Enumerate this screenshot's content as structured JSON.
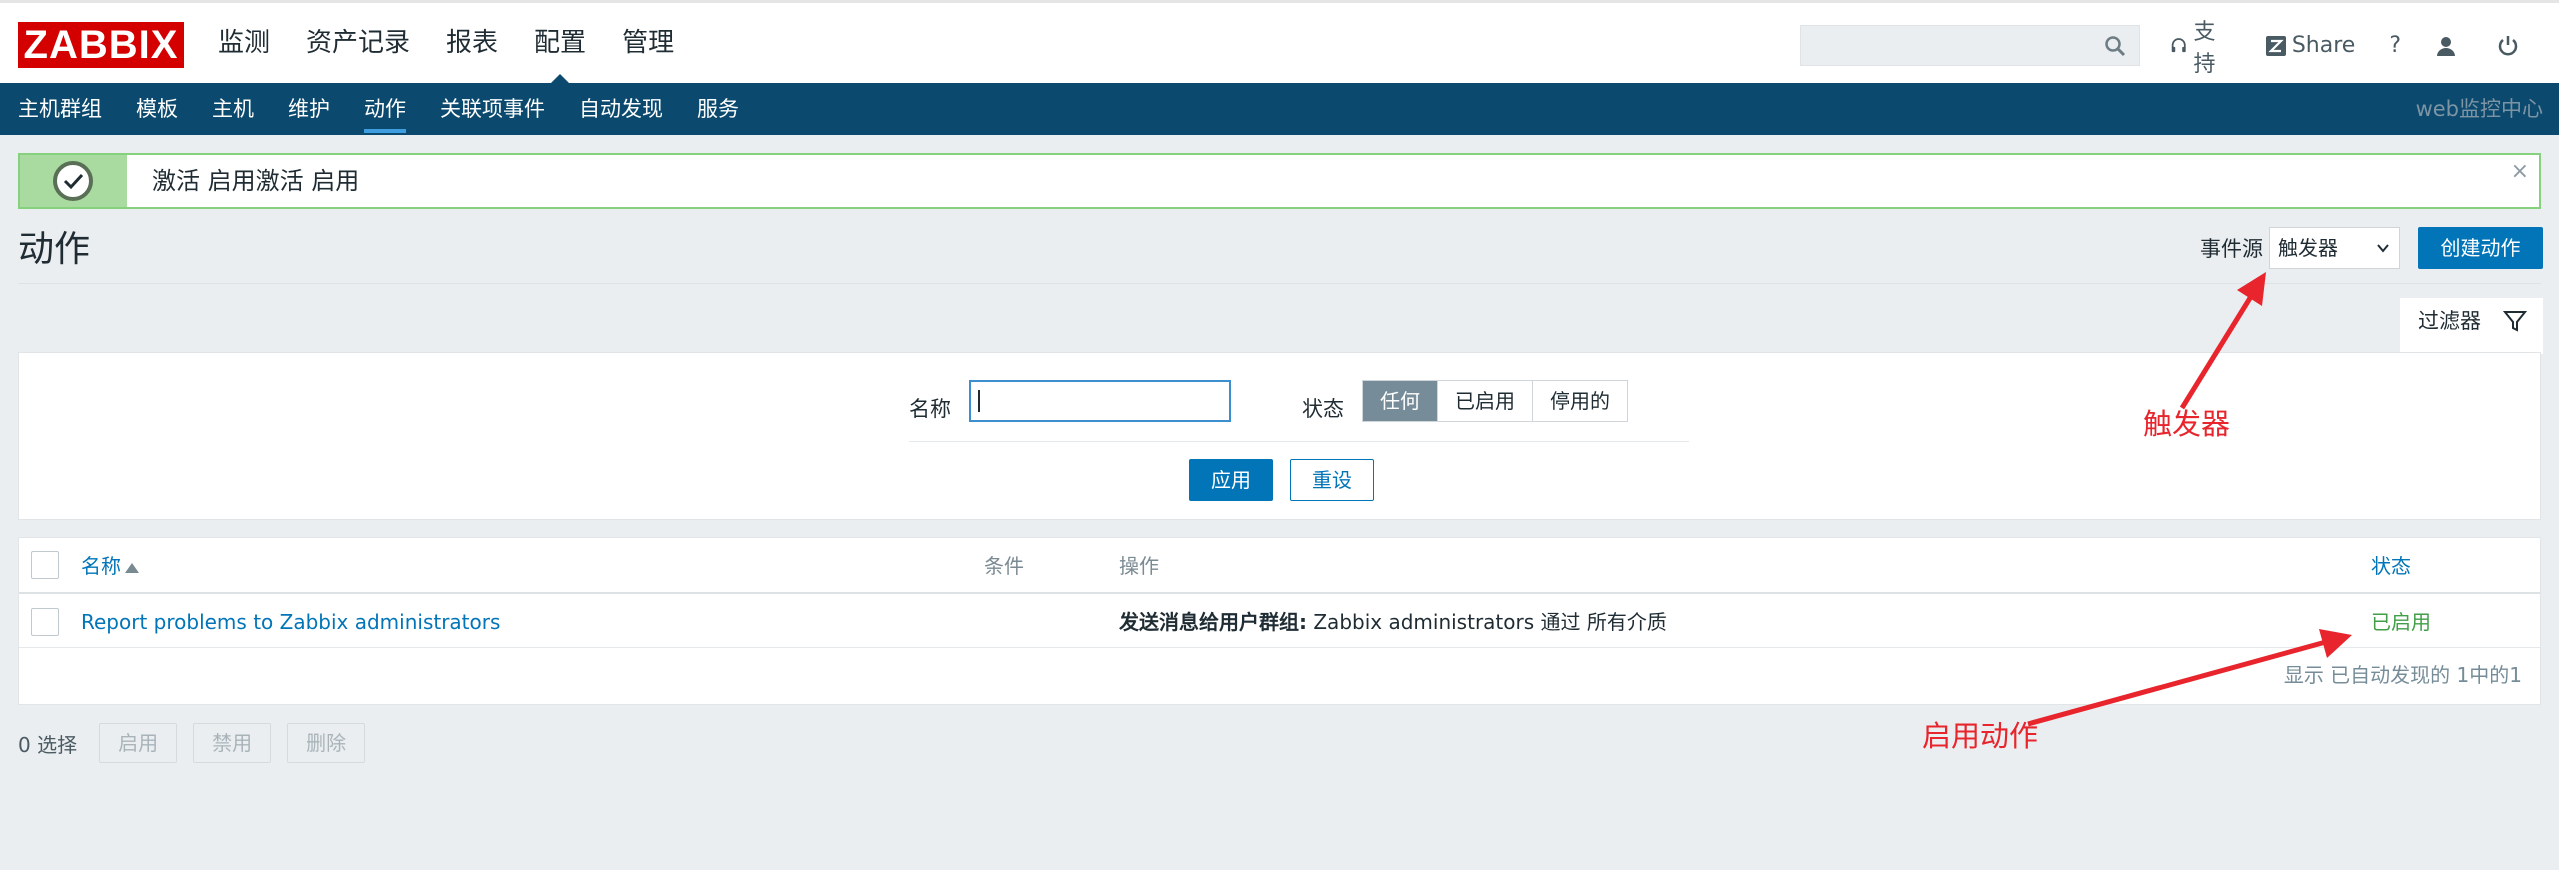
{
  "brand": {
    "logo": "ZABBIX"
  },
  "main_menu": [
    "监测",
    "资产记录",
    "报表",
    "配置",
    "管理"
  ],
  "main_menu_active": "配置",
  "header_tools": {
    "support": "支持",
    "share": "Share",
    "help": "?"
  },
  "sub_menu": [
    "主机群组",
    "模板",
    "主机",
    "维护",
    "动作",
    "关联项事件",
    "自动发现",
    "服务"
  ],
  "sub_menu_active": "动作",
  "sub_right": "web监控中心",
  "message": {
    "text": "激活 启用激活 启用",
    "close": "×"
  },
  "page": {
    "title": "动作",
    "event_source_label": "事件源",
    "event_source_value": "触发器",
    "create_button": "创建动作"
  },
  "filter": {
    "tab_label": "过滤器",
    "name_label": "名称",
    "name_value": "",
    "status_label": "状态",
    "status_options": [
      "任何",
      "已启用",
      "停用的"
    ],
    "status_selected": "任何",
    "apply": "应用",
    "reset": "重设"
  },
  "table": {
    "columns": [
      "名称",
      "条件",
      "操作",
      "状态"
    ],
    "rows": [
      {
        "name": "Report problems to Zabbix administrators",
        "conditions": "",
        "operation_label": "发送消息给用户群组:",
        "operation_text": " Zabbix administrators 通过 所有介质",
        "status": "已启用"
      }
    ],
    "footer": "显示 已自动发现的 1中的1"
  },
  "bulk": {
    "count": "0 选择",
    "buttons": [
      "启用",
      "禁用",
      "删除"
    ]
  },
  "annotations": {
    "trigger": "触发器",
    "enable": "启用动作"
  },
  "colors": {
    "brand_red": "#d40000",
    "nav_bg": "#0b4a6e",
    "primary": "#0275b8",
    "success": "#429e47",
    "annotation": "#e8242c"
  }
}
